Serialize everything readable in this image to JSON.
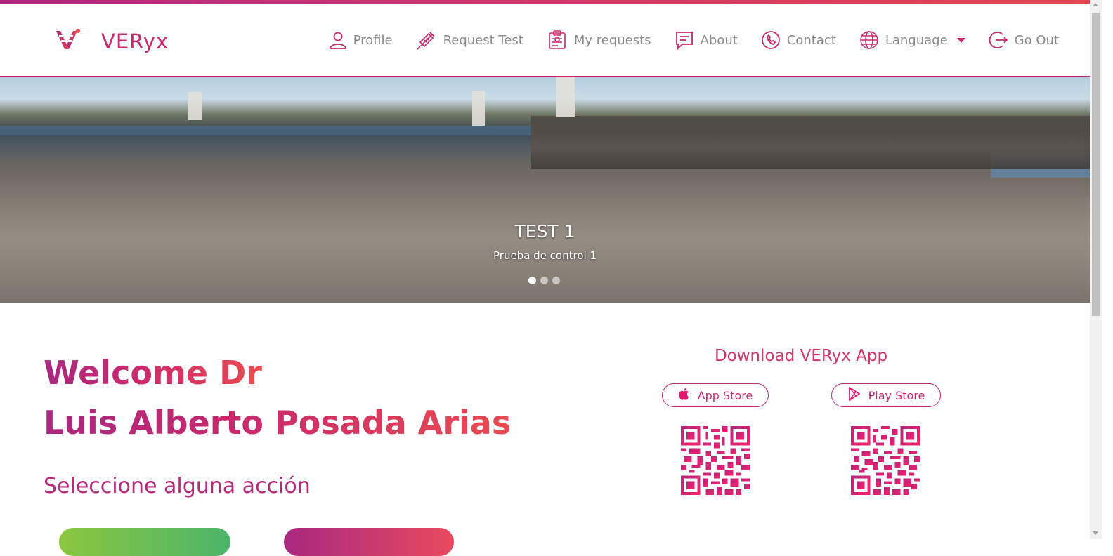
{
  "brand": {
    "name": "VERyx"
  },
  "nav": [
    {
      "id": "profile",
      "label": "Profile",
      "icon": "user-icon"
    },
    {
      "id": "request-test",
      "label": "Request Test",
      "icon": "syringe-icon"
    },
    {
      "id": "my-requests",
      "label": "My requests",
      "icon": "clipboard-icon"
    },
    {
      "id": "about",
      "label": "About",
      "icon": "message-icon"
    },
    {
      "id": "contact",
      "label": "Contact",
      "icon": "phone-icon"
    },
    {
      "id": "language",
      "label": "Language",
      "icon": "globe-icon",
      "dropdown": true
    },
    {
      "id": "go-out",
      "label": "Go Out",
      "icon": "logout-icon"
    }
  ],
  "carousel": {
    "title": "TEST 1",
    "subtitle": "Prueba de control 1",
    "slide_count": 3,
    "active_index": 0
  },
  "welcome": {
    "line1": "Welcome Dr",
    "line2": "Luis Alberto Posada Arias",
    "prompt": "Seleccione alguna acción"
  },
  "download": {
    "title": "Download VERyx App",
    "app_store_label": "App Store",
    "play_store_label": "Play Store"
  },
  "colors": {
    "accent": "#c8286e",
    "gradient_start": "#a8287f",
    "gradient_end": "#ec4a4f",
    "nav_text": "#8a8a8a"
  }
}
